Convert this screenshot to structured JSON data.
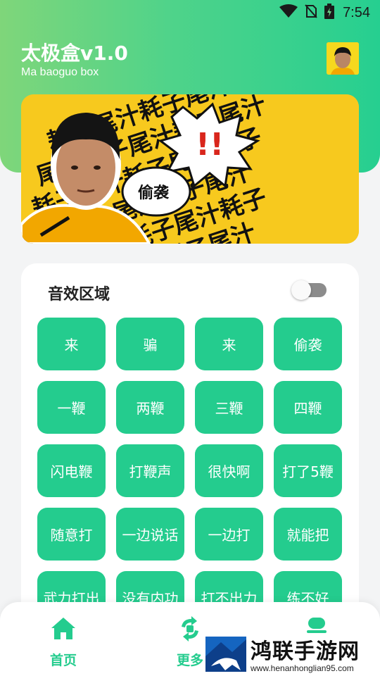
{
  "status_bar": {
    "time": "7:54",
    "icons": [
      "wifi-icon",
      "no-sim-icon",
      "battery-charging-icon"
    ]
  },
  "header": {
    "title": "太极盒v1.0",
    "subtitle": "Ma baoguo box",
    "avatar_icon": "avatar-image"
  },
  "banner": {
    "pattern_text": "耗子尾汁",
    "bubble_text": "偷袭",
    "exclaim": "!!"
  },
  "sound_area": {
    "title": "音效区域",
    "toggle_on": false,
    "buttons": [
      "来",
      "骗",
      "来",
      "偷袭",
      "一鞭",
      "两鞭",
      "三鞭",
      "四鞭",
      "闪电鞭",
      "打鞭声",
      "很快啊",
      "打了5鞭",
      "随意打",
      "一边说话",
      "一边打",
      "就能把",
      "武力打出",
      "没有内功",
      "打不出力",
      "练不好"
    ]
  },
  "bottom_nav": {
    "items": [
      {
        "label": "首页",
        "icon": "home-icon"
      },
      {
        "label": "更多",
        "icon": "refresh-icon"
      },
      {
        "label": "",
        "icon": "profile-icon"
      }
    ]
  },
  "watermark": {
    "text": "鸿联手游网",
    "url": "www.henanhonglian95.com"
  },
  "colors": {
    "accent": "#24cc8e",
    "header_start": "#7fd67a",
    "header_end": "#26cf90",
    "banner_yellow": "#f7c91e"
  }
}
